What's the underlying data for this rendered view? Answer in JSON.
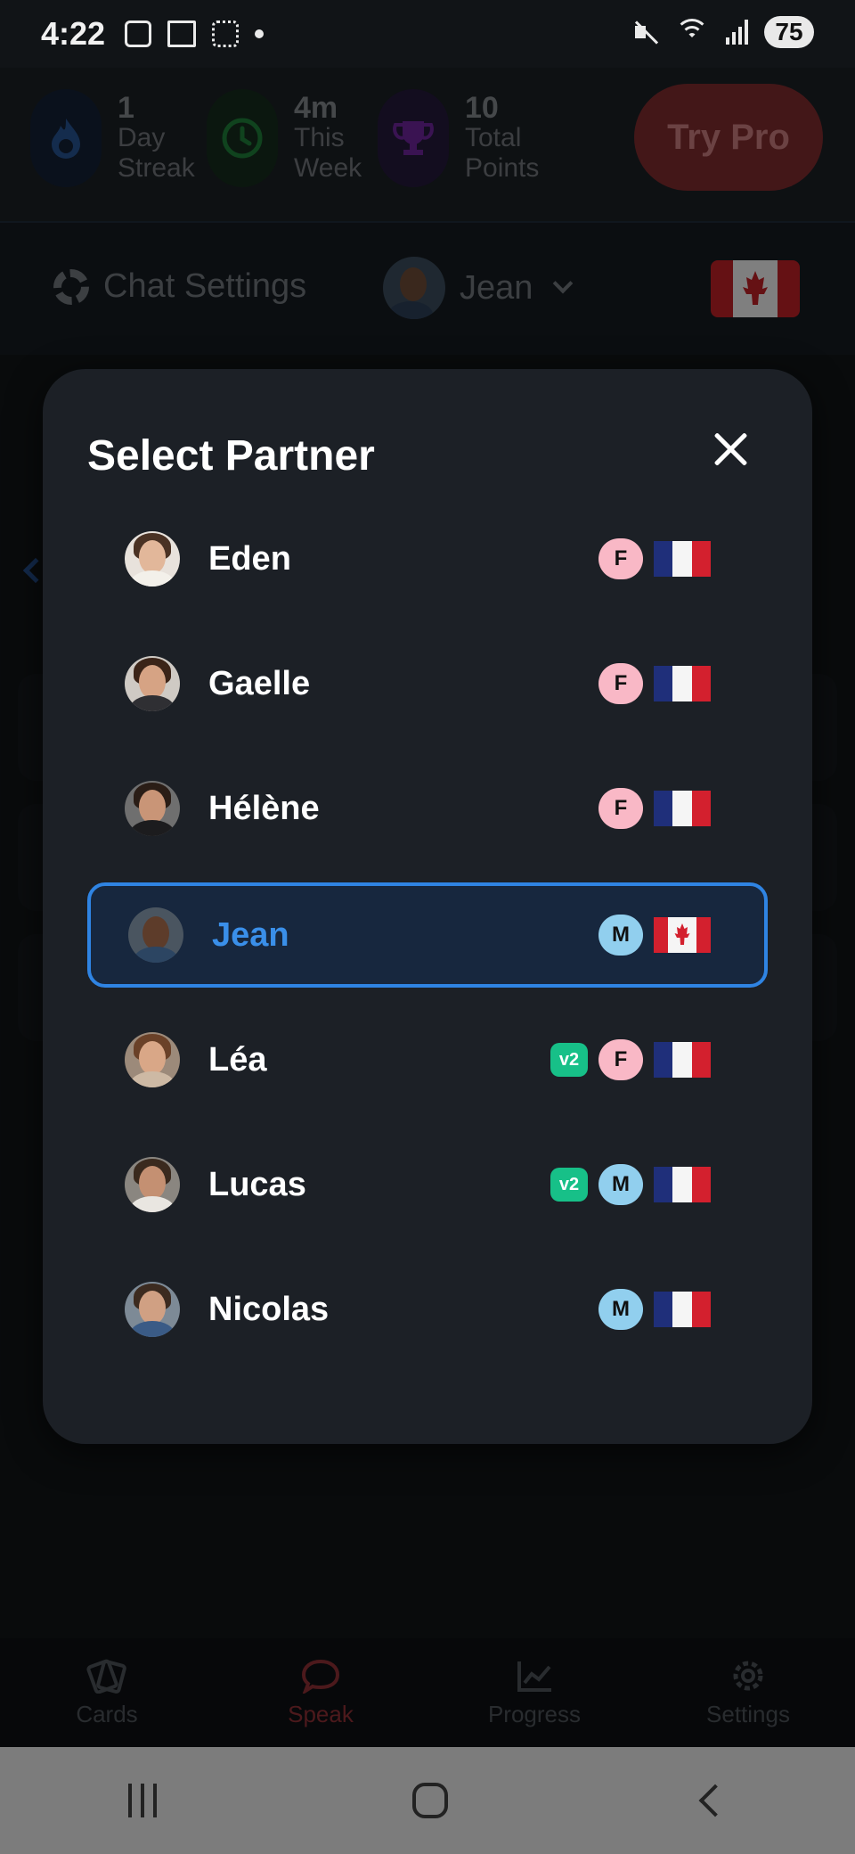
{
  "status_bar": {
    "time": "4:22",
    "battery": "75"
  },
  "stats": {
    "streak_value": "1",
    "streak_label_1": "Day",
    "streak_label_2": "Streak",
    "week_value": "4m",
    "week_label_1": "This",
    "week_label_2": "Week",
    "points_value": "10",
    "points_label_1": "Total",
    "points_label_2": "Points",
    "try_pro": "Try Pro"
  },
  "chat_bar": {
    "settings_label": "Chat Settings",
    "selected_partner": "Jean"
  },
  "modal": {
    "title": "Select Partner",
    "partners": [
      {
        "name": "Eden",
        "gender": "F",
        "flag": "fr",
        "v2": ""
      },
      {
        "name": "Gaelle",
        "gender": "F",
        "flag": "fr",
        "v2": ""
      },
      {
        "name": "Hélène",
        "gender": "F",
        "flag": "fr",
        "v2": ""
      },
      {
        "name": "Jean",
        "gender": "M",
        "flag": "ca",
        "v2": "",
        "selected": true
      },
      {
        "name": "Léa",
        "gender": "F",
        "flag": "fr",
        "v2": "v2"
      },
      {
        "name": "Lucas",
        "gender": "M",
        "flag": "fr",
        "v2": "v2"
      },
      {
        "name": "Nicolas",
        "gender": "M",
        "flag": "fr",
        "v2": ""
      }
    ]
  },
  "bottom_nav": {
    "cards": "Cards",
    "speak": "Speak",
    "progress": "Progress",
    "settings": "Settings"
  },
  "colors": {
    "accent_blue": "#2f84e3",
    "female_badge": "#f9b8c6",
    "male_badge": "#91cfee",
    "v2_badge": "#17c088"
  }
}
